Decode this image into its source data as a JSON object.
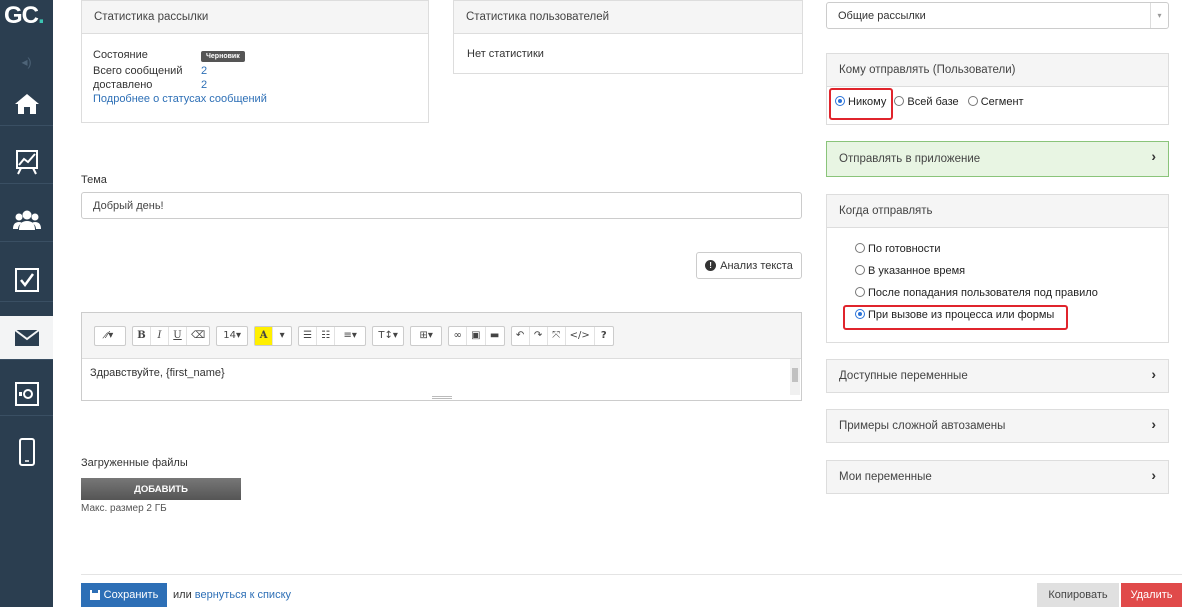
{
  "logo": {
    "text": "GC",
    "dot": "."
  },
  "stats_mail": {
    "title": "Статистика рассылки",
    "state_label": "Состояние",
    "state_badge": "Черновик",
    "total_label": "Всего сообщений",
    "total_value": "2",
    "delivered_label": "доставлено",
    "delivered_value": "2",
    "more_link": "Подробнее о статусах сообщений"
  },
  "stats_users": {
    "title": "Статистика пользователей",
    "empty": "Нет статистики"
  },
  "subject": {
    "label": "Тема",
    "value": "Добрый день!"
  },
  "analyze_button": "Анализ текста",
  "editor": {
    "toolbar": {
      "font_size": "14▾",
      "heading": "T↕▾"
    },
    "content": "Здравствуйте, {first_name}"
  },
  "files": {
    "label": "Загруженные файлы",
    "add_button": "ДОБАВИТЬ",
    "max_size": "Макс. размер 2 ГБ"
  },
  "footer": {
    "save": "Сохранить",
    "or": "или",
    "back_link": "вернуться к списку",
    "copy": "Копировать",
    "delete": "Удалить"
  },
  "right": {
    "mailing_select": "Общие рассылки",
    "recipients": {
      "title": "Кому отправлять (Пользователи)",
      "options": [
        "Никому",
        "Всей базе",
        "Сегмент"
      ],
      "selected": "Никому"
    },
    "send_to_app": "Отправлять в приложение",
    "when": {
      "title": "Когда отправлять",
      "options": [
        "По готовности",
        "В указанное время",
        "После попадания пользователя под правило",
        "При вызове из процесса или формы"
      ],
      "selected": "При вызове из процесса или формы"
    },
    "accordions": [
      "Доступные переменные",
      "Примеры сложной автозамены",
      "Мои переменные"
    ]
  },
  "colors": {
    "sidebar": "#2b3e50",
    "accent": "#2d6fb6",
    "delete": "#e04a4a",
    "highlight": "#e0242c",
    "app_panel": "#e8f5e3"
  }
}
